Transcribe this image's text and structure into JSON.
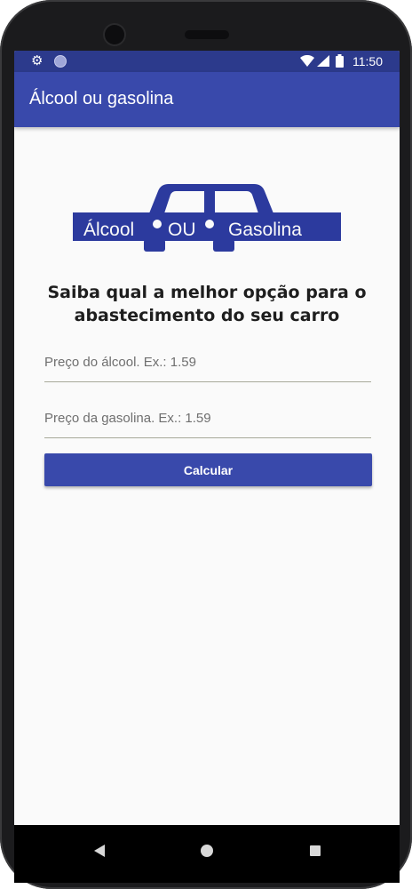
{
  "status_bar": {
    "time": "11:50",
    "icons": [
      "gear-icon",
      "notification-dot-icon",
      "wifi-icon",
      "signal-icon",
      "battery-icon"
    ]
  },
  "app_bar": {
    "title": "Álcool ou gasolina"
  },
  "logo": {
    "left_text": "Álcool",
    "middle_text": "OU",
    "right_text": "Gasolina",
    "color": "#2c3a9e"
  },
  "main": {
    "headline": "Saiba qual a melhor opção para o abastecimento do seu carro",
    "alcool_field": {
      "value": "",
      "placeholder": "Preço do álcool. Ex.: 1.59"
    },
    "gasolina_field": {
      "value": "",
      "placeholder": "Preço da gasolina. Ex.: 1.59"
    },
    "calculate_button": "Calcular"
  },
  "nav_bar": {
    "icons": [
      "back-icon",
      "home-icon",
      "recent-apps-icon"
    ]
  },
  "colors": {
    "primary": "#3949ab",
    "primary_dark": "#2c3a8c",
    "background": "#fafafa"
  }
}
